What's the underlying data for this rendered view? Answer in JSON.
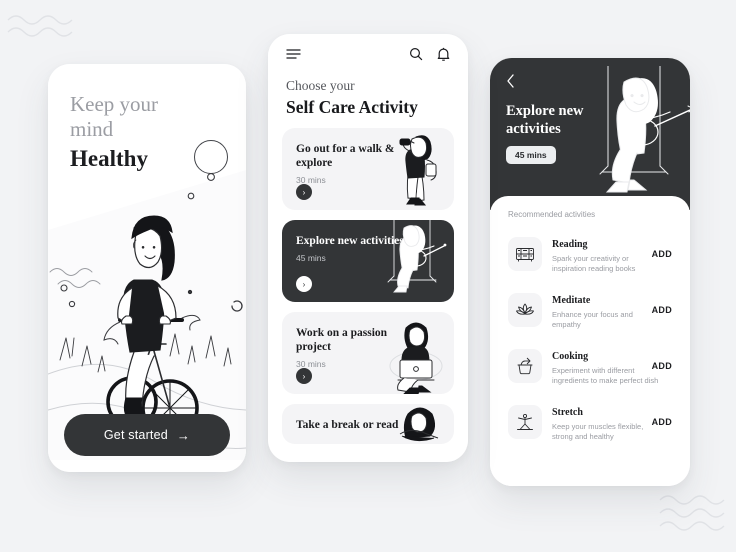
{
  "background": {
    "decoration": "wave-lines",
    "color": "#f2f3f5",
    "accent": "#333537"
  },
  "screen_onboarding": {
    "heading_line1": "Keep your",
    "heading_line2": "mind",
    "heading_line3": "Healthy",
    "illustration": "woman-riding-bicycle-illustration",
    "cta_label": "Get started",
    "cta_arrow": "→"
  },
  "screen_activities": {
    "menu_icon": "hamburger-menu-icon",
    "search_icon": "search-icon",
    "bell_icon": "notification-bell-icon",
    "kicker": "Choose your",
    "title": "Self Care Activity",
    "cards": [
      {
        "title": "Go out for a walk & explore",
        "duration": "30 mins",
        "active": false,
        "illustration": "woman-with-binoculars-illustration",
        "arrow": "›"
      },
      {
        "title": "Explore new activities",
        "duration": "45 mins",
        "active": true,
        "illustration": "woman-playing-guitar-on-swing-illustration",
        "arrow": "›"
      },
      {
        "title": "Work on a passion project",
        "duration": "30 mins",
        "active": false,
        "illustration": "woman-with-laptop-illustration",
        "arrow": "›"
      },
      {
        "title": "Take a break or read",
        "duration": "",
        "active": false,
        "illustration": "woman-reading-illustration",
        "arrow": "›"
      }
    ]
  },
  "screen_detail": {
    "back_icon": "chevron-left-icon",
    "title": "Explore new activities",
    "duration_badge": "45 mins",
    "hero_illustration": "woman-playing-guitar-on-swing-illustration",
    "section_label": "Recommended activities",
    "add_label": "ADD",
    "items": [
      {
        "name": "Reading",
        "description": "Spark your creativity or inspiration reading books",
        "icon": "bookshelf-icon"
      },
      {
        "name": "Meditate",
        "description": "Enhance your focus and empathy",
        "icon": "lotus-flower-icon"
      },
      {
        "name": "Cooking",
        "description": "Experiment with different ingredients to make perfect dish",
        "icon": "cooking-pot-icon"
      },
      {
        "name": "Stretch",
        "description": "Keep your muscles flexible, strong and healthy",
        "icon": "stretching-person-icon"
      }
    ]
  }
}
